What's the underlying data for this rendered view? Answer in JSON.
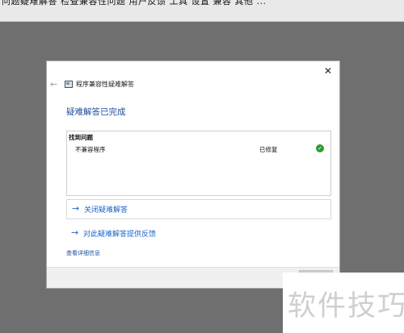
{
  "top_strip": {
    "text": "问题疑难解答 检查兼容性问题 用户反馈 工具 设置 兼容 其他 ..."
  },
  "dialog": {
    "title": "程序兼容性疑难解答",
    "close_glyph": "✕",
    "back_glyph": "←",
    "heading": "疑难解答已完成",
    "problems": {
      "header": "找到问题",
      "items": [
        {
          "name": "不兼容程序",
          "status": "已修复",
          "status_icon": "check-icon"
        }
      ]
    },
    "actions": {
      "close_troubleshooter": "关闭疑难解答",
      "feedback": "对此疑难解答提供反馈",
      "arrow_glyph": "→"
    },
    "details_link": "查看详细信息"
  },
  "watermark": {
    "text": "软件技巧"
  }
}
